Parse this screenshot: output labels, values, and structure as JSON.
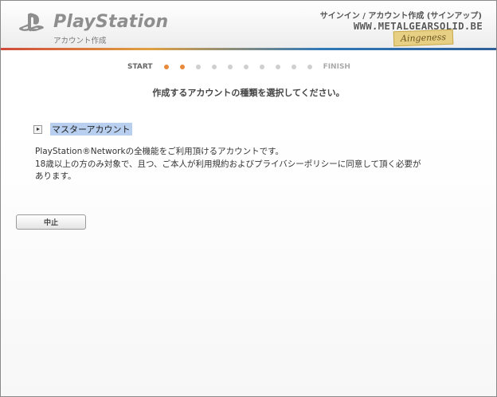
{
  "header": {
    "brand": "PlayStation",
    "brand_sub": "アカウント作成",
    "title": "サインイン / アカウント作成 (サインアップ)",
    "watermark": "WWW.METALGEARSOLID.BE",
    "watermark_tag": "Aingeness"
  },
  "progress": {
    "start_label": "START",
    "finish_label": "FINISH",
    "total_steps": 10,
    "completed_steps": 2
  },
  "instruction": "作成するアカウントの種類を選択してください。",
  "account_option": {
    "label": "マスターアカウント"
  },
  "description": {
    "line1": "PlayStation®Networkの全機能をご利用頂けるアカウントです。",
    "line2": "18歳以上の方のみ対象で、且つ、ご本人が利用規約およびプライバシーポリシーに同意して頂く必要が",
    "line3": "あります。"
  },
  "cancel_button": {
    "label": "中止"
  },
  "colors": {
    "accent": "#e8893b",
    "selection": "#b8cff0",
    "inactive_dot": "#cfcfcf"
  }
}
